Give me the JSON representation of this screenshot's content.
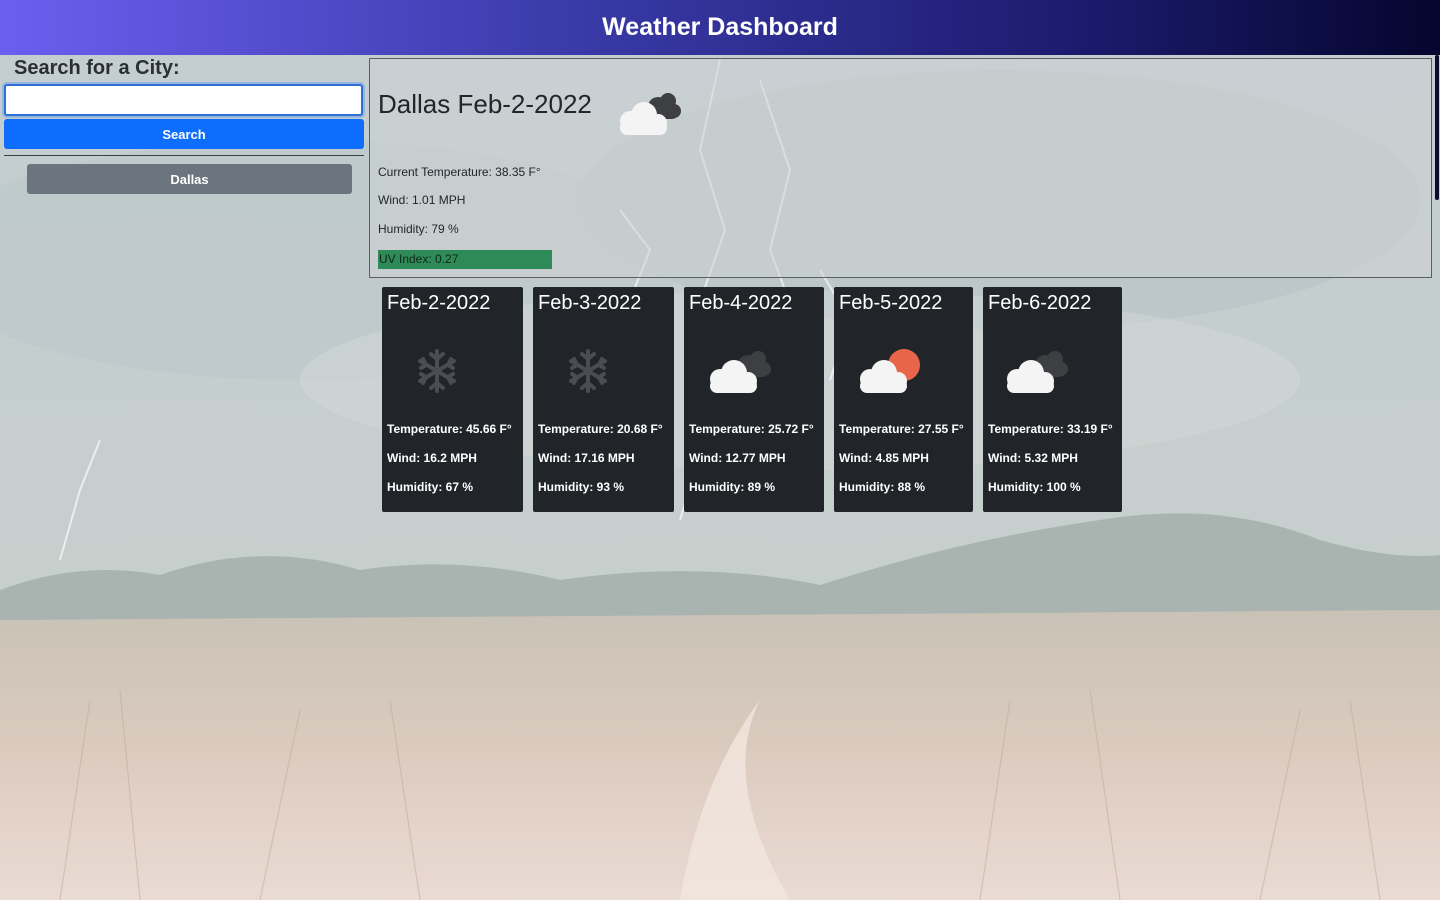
{
  "header": {
    "title": "Weather Dashboard"
  },
  "sidebar": {
    "search_label": "Search for a City:",
    "search_value": "",
    "search_placeholder": "",
    "search_button": "Search",
    "history": [
      "Dallas"
    ]
  },
  "current": {
    "title": "Dallas Feb-2-2022",
    "icon": "cloudy-icon",
    "temperature": "Current Temperature: 38.35 F°",
    "wind": "Wind: 1.01 MPH",
    "humidity": "Humidity: 79 %",
    "uv": "UV Index: 0.27",
    "uv_color": "#2e8b57"
  },
  "forecast": [
    {
      "date": "Feb-2-2022",
      "icon": "snowflake-icon",
      "temperature": "Temperature: 45.66 F°",
      "wind": "Wind: 16.2 MPH",
      "humidity": "Humidity: 67 %"
    },
    {
      "date": "Feb-3-2022",
      "icon": "snowflake-icon",
      "temperature": "Temperature: 20.68 F°",
      "wind": "Wind: 17.16 MPH",
      "humidity": "Humidity: 93 %"
    },
    {
      "date": "Feb-4-2022",
      "icon": "cloudy-icon",
      "temperature": "Temperature: 25.72 F°",
      "wind": "Wind: 12.77 MPH",
      "humidity": "Humidity: 89 %"
    },
    {
      "date": "Feb-5-2022",
      "icon": "partly-cloudy-icon",
      "temperature": "Temperature: 27.55 F°",
      "wind": "Wind: 4.85 MPH",
      "humidity": "Humidity: 88 %"
    },
    {
      "date": "Feb-6-2022",
      "icon": "cloudy-icon",
      "temperature": "Temperature: 33.19 F°",
      "wind": "Wind: 5.32 MPH",
      "humidity": "Humidity: 100 %"
    }
  ],
  "colors": {
    "header_gradient_start": "#6a5ff0",
    "header_gradient_end": "#05052e",
    "search_button": "#0d6efd",
    "history_button": "#6c757d",
    "card_background": "#212529",
    "uv_badge": "#2e8b57"
  }
}
